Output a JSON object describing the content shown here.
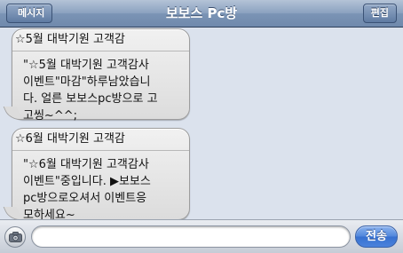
{
  "navbar": {
    "title": "보보스 Pc방",
    "back_label": "메시지",
    "edit_label": "편집"
  },
  "messages": [
    {
      "subject": "☆5월 대박기원 고객감",
      "body": "\"☆5월 대박기원 고객감사\n이벤트\"마감\"하루남았습니\n다. 얼른 보보스pc방으로 고\n고씽~^^;"
    },
    {
      "subject": "☆6월 대박기원 고객감",
      "body": "\"☆6월 대박기원 고객감사\n이벤트\"중입니다. ▶보보스\npc방으로오셔서 이벤트응\n모하세요~"
    }
  ],
  "input": {
    "value": "",
    "placeholder": ""
  },
  "send_label": "전송",
  "icons": {
    "camera": "camera-icon"
  },
  "colors": {
    "navbar": "#7b94b5",
    "background": "#dbe2ed",
    "send_button": "#4a82dc"
  }
}
